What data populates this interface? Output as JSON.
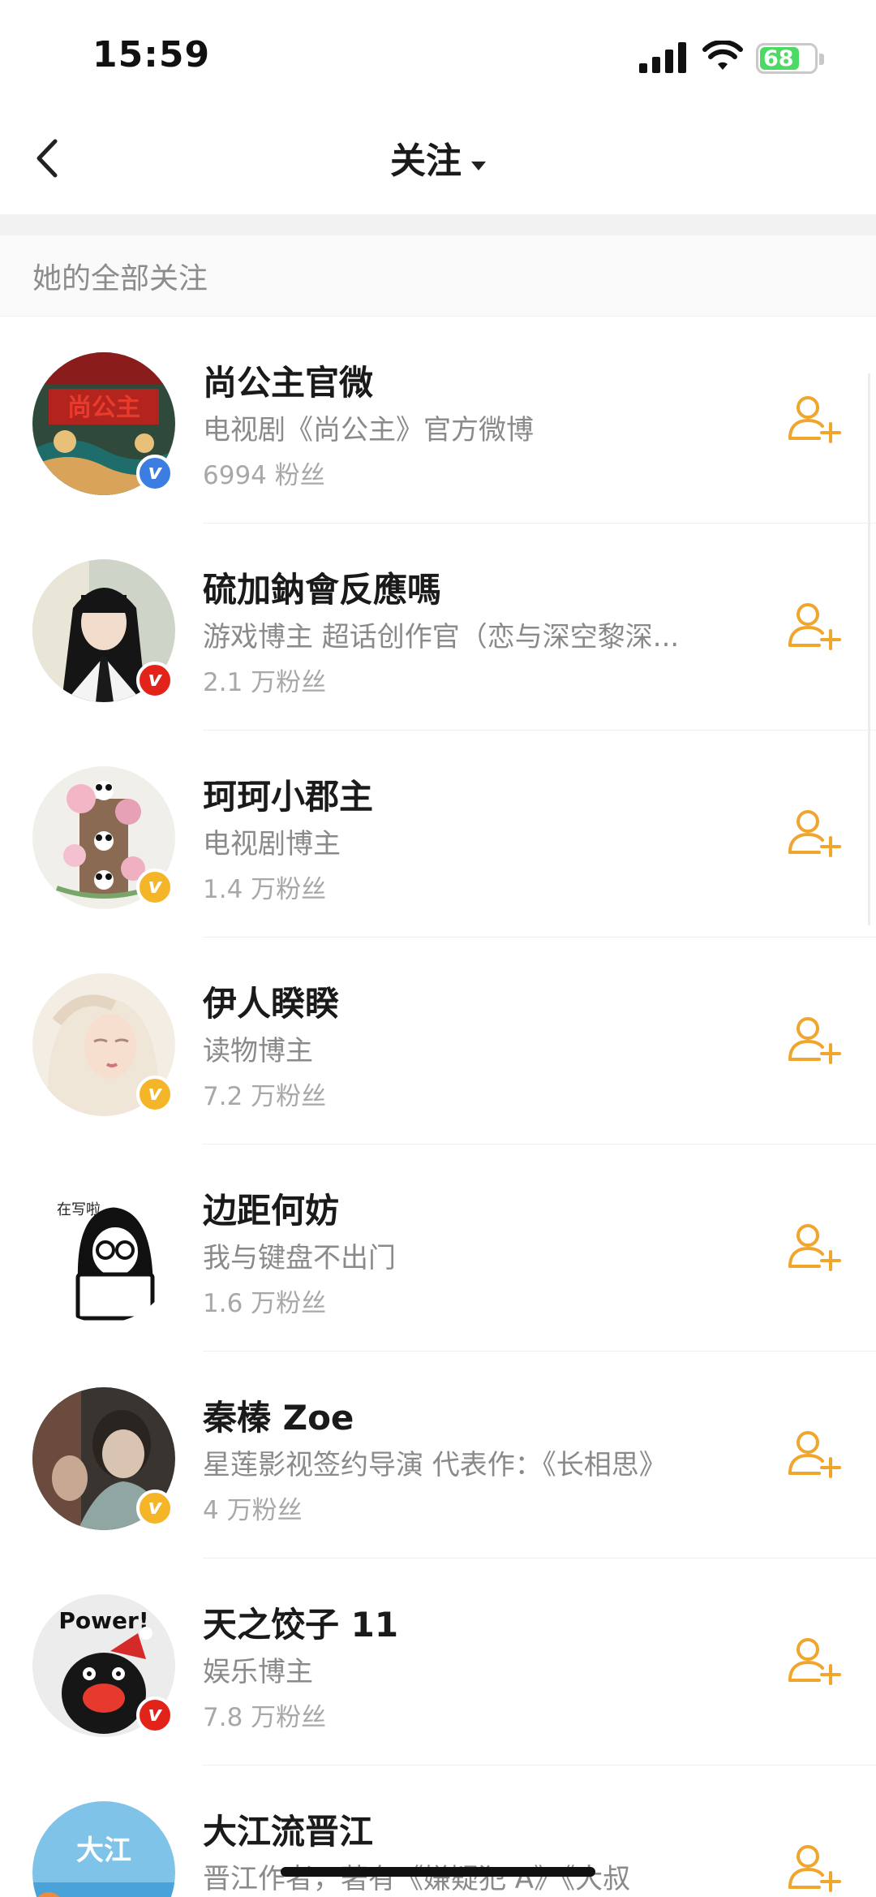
{
  "status_bar": {
    "time": "15:59",
    "battery_percent": "68",
    "battery_level": 0.68,
    "icons": [
      "signal-icon",
      "wifi-icon",
      "battery-icon"
    ]
  },
  "nav": {
    "back_icon": "chevron-left-icon",
    "title": "关注",
    "title_icon": "caret-down-icon"
  },
  "section": {
    "header": "她的全部关注"
  },
  "colors": {
    "accent": "#f0a52c",
    "badge_blue": "#3b7de1",
    "badge_red": "#e2231a",
    "badge_gold": "#f5b528"
  },
  "follows": [
    {
      "name": "尚公主官微",
      "desc": "电视剧《尚公主》官方微博",
      "fans": "6994 粉丝",
      "badge": "blue",
      "avatar_icon": "palace-artwork-avatar"
    },
    {
      "name": "硫加鈉會反應嗎",
      "desc": "游戏博主 超话创作官（恋与深空黎深...",
      "fans": "2.1 万粉丝",
      "badge": "red",
      "avatar_icon": "girl-photo-avatar"
    },
    {
      "name": "珂珂小郡主",
      "desc": "电视剧博主",
      "fans": "1.4 万粉丝",
      "badge": "gold",
      "avatar_icon": "panda-tower-avatar"
    },
    {
      "name": "伊人睽睽",
      "desc": "读物博主",
      "fans": "7.2 万粉丝",
      "badge": "gold",
      "avatar_icon": "illustrated-woman-avatar"
    },
    {
      "name": "边距何妨",
      "desc": "我与键盘不出门",
      "fans": "1.6 万粉丝",
      "badge": "none",
      "avatar_icon": "laptop-doodle-avatar",
      "avatar_text": "在写啦"
    },
    {
      "name": "秦榛 Zoe",
      "desc": "星莲影视签约导演 代表作：《长相思》",
      "fans": "4 万粉丝",
      "badge": "gold",
      "avatar_icon": "photo-avatar"
    },
    {
      "name": "天之饺子 11",
      "desc": "娱乐博主",
      "fans": "7.8 万粉丝",
      "badge": "red",
      "avatar_icon": "power-penguin-avatar",
      "avatar_text": "Power!"
    },
    {
      "name": "大江流晋江",
      "desc": "晋江作者，著有《嫌疑犯 A》《大叔",
      "fans": "",
      "badge": "none",
      "avatar_icon": "river-avatar",
      "avatar_text": "大江"
    }
  ],
  "follow_button_icon": "add-user-icon"
}
